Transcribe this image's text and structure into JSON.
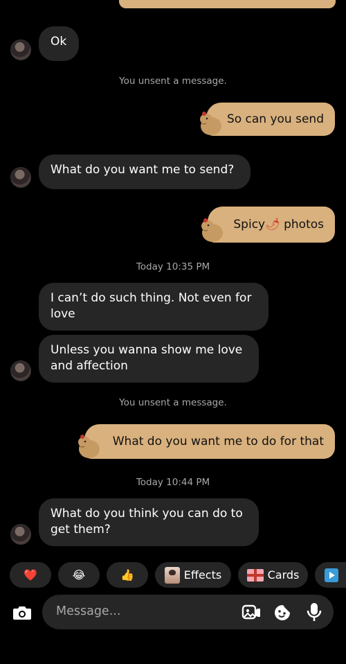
{
  "messages": [
    {
      "kind": "incoming",
      "text": "Ok"
    },
    {
      "kind": "system",
      "text": "You unsent a message."
    },
    {
      "kind": "outgoing",
      "text": "So can you send"
    },
    {
      "kind": "incoming",
      "text": "What do you want me to send?"
    },
    {
      "kind": "outgoing",
      "text_before": "Spicy",
      "emoji": "🌶",
      "text_after": " photos"
    },
    {
      "kind": "timestamp",
      "text": "Today 10:35 PM"
    },
    {
      "kind": "incoming",
      "text": "I can’t do such thing. Not even for love"
    },
    {
      "kind": "incoming",
      "text": "Unless you wanna show me love and affection"
    },
    {
      "kind": "system",
      "text": "You unsent a message."
    },
    {
      "kind": "outgoing",
      "text": "What do you want me to do for that"
    },
    {
      "kind": "timestamp",
      "text": "Today 10:44 PM"
    },
    {
      "kind": "incoming",
      "text": "What do you think you can do to get them?"
    }
  ],
  "quick_reactions": [
    {
      "icon": "heart-icon",
      "glyph": "❤️"
    },
    {
      "icon": "laughing-face-icon",
      "glyph": "😂"
    },
    {
      "icon": "thumbs-up-icon",
      "glyph": "👍"
    }
  ],
  "effects_label": "Effects",
  "cards_label": "Cards",
  "composer": {
    "placeholder": "Message..."
  },
  "colors": {
    "background": "#000000",
    "incoming_bubble": "#262626",
    "outgoing_bubble": "#d9b17e",
    "secondary_text": "#a8a8a8"
  }
}
